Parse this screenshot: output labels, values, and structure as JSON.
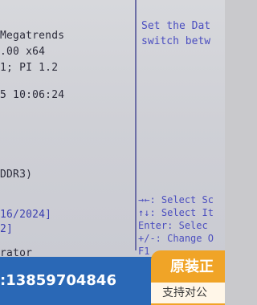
{
  "bios": {
    "left_lines": [
      "Megatrends",
      ".00 x64",
      "1; PI 1.2",
      "5 10:06:24",
      "DDR3)",
      "16/2024]",
      "2]",
      "rator"
    ],
    "help_lines": [
      "Set the Dat",
      "switch betw"
    ],
    "hints": [
      {
        "keys": "→←:",
        "text": "Select Sc"
      },
      {
        "keys": "↑↓:",
        "text": "Select It"
      },
      {
        "keys": "Enter:",
        "text": "Selec"
      },
      {
        "keys": "+/-:",
        "text": "Change O"
      },
      {
        "keys": "F1",
        "text": ""
      }
    ]
  },
  "overlay": {
    "phone": ":13859704846",
    "badge_title": "原装正",
    "badge_sub": "支持对公"
  },
  "colors": {
    "bios_background": "#d0d1d7",
    "bios_text": "#2b2b3a",
    "bios_blue": "#4a4dc0",
    "overlay_bar": "#2a68b6",
    "badge": "#f0a427"
  }
}
